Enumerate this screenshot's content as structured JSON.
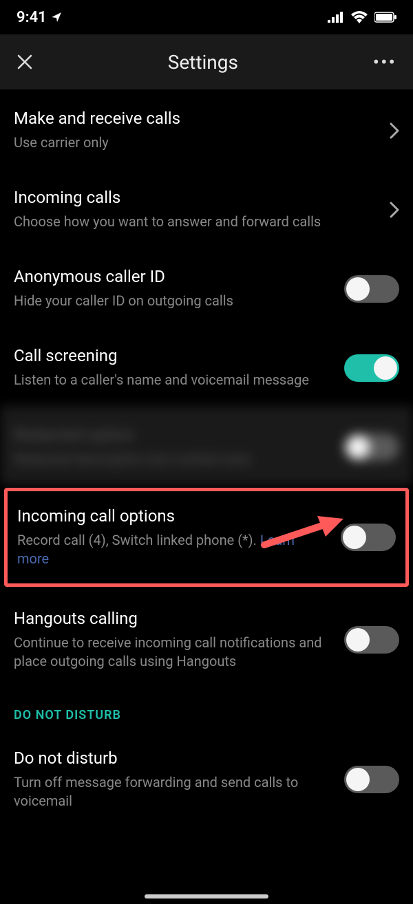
{
  "status": {
    "time": "9:41"
  },
  "header": {
    "title": "Settings"
  },
  "rows": {
    "makeCalls": {
      "title": "Make and receive calls",
      "sub": "Use carrier only"
    },
    "incoming": {
      "title": "Incoming calls",
      "sub": "Choose how you want to answer and forward calls"
    },
    "anonId": {
      "title": "Anonymous caller ID",
      "sub": "Hide your caller ID on outgoing calls",
      "toggle": false
    },
    "screening": {
      "title": "Call screening",
      "sub": "Listen to a caller's name and voicemail message",
      "toggle": true
    },
    "redacted": {
      "title": "Redacted option",
      "sub": "Redacted description text content area",
      "toggle": false
    },
    "incOptions": {
      "title": "Incoming call options",
      "subPrefix": "Record call (4), Switch linked phone (*). ",
      "link": "Learn more",
      "toggle": false
    },
    "hangouts": {
      "title": "Hangouts calling",
      "sub": "Continue to receive incoming call notifications and place outgoing calls using Hangouts",
      "toggle": false
    },
    "dnd": {
      "title": "Do not disturb",
      "sub": "Turn off message forwarding and send calls to voicemail",
      "toggle": false
    }
  },
  "section": {
    "dnd": "DO NOT DISTURB"
  }
}
